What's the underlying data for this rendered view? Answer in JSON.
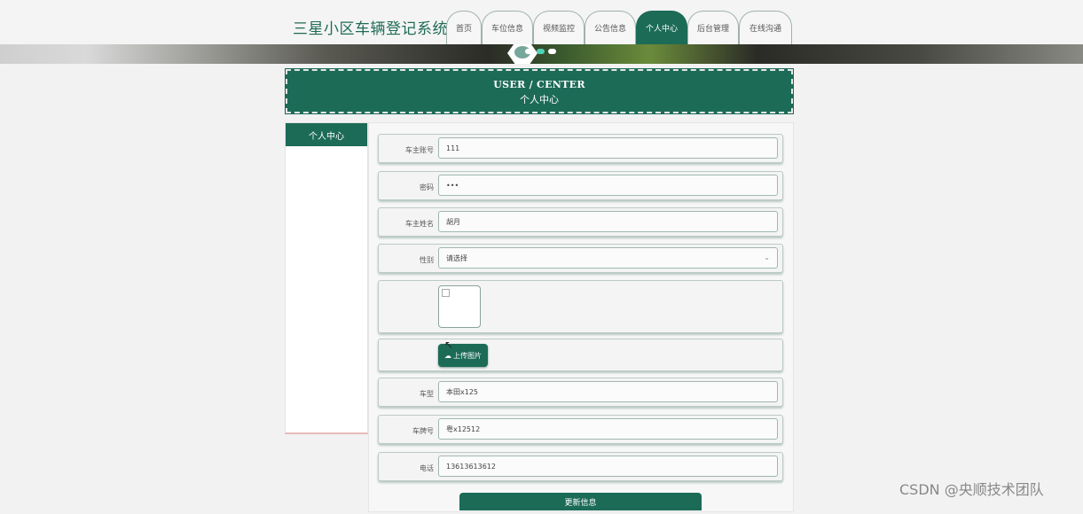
{
  "header": {
    "site_title": "三星小区车辆登记系统",
    "nav": [
      {
        "label": "首页"
      },
      {
        "label": "车位信息"
      },
      {
        "label": "视频监控"
      },
      {
        "label": "公告信息"
      },
      {
        "label": "个人中心",
        "active": true
      },
      {
        "label": "后台管理"
      },
      {
        "label": "在线沟通"
      }
    ]
  },
  "banner": {
    "active_dot": 1
  },
  "page_heading": {
    "en": "USER / CENTER",
    "zh": "个人中心"
  },
  "sidebar": {
    "item": "个人中心"
  },
  "form": {
    "fields": [
      {
        "label": "车主账号",
        "value": "111"
      },
      {
        "label": "密码",
        "value": "•••"
      },
      {
        "label": "车主姓名",
        "value": "胡月"
      },
      {
        "label": "性别",
        "value": "请选择"
      },
      {
        "label": "车型",
        "value": "本田x125"
      },
      {
        "label": "车牌号",
        "value": "粤x12512"
      },
      {
        "label": "电话",
        "value": "13613613612"
      }
    ],
    "upload_label": "上传图片",
    "save_label": "更新信息"
  },
  "watermark": "CSDN @央顺技术团队",
  "colors": {
    "accent": "#1c6b57",
    "background": "#f2f2f2"
  }
}
